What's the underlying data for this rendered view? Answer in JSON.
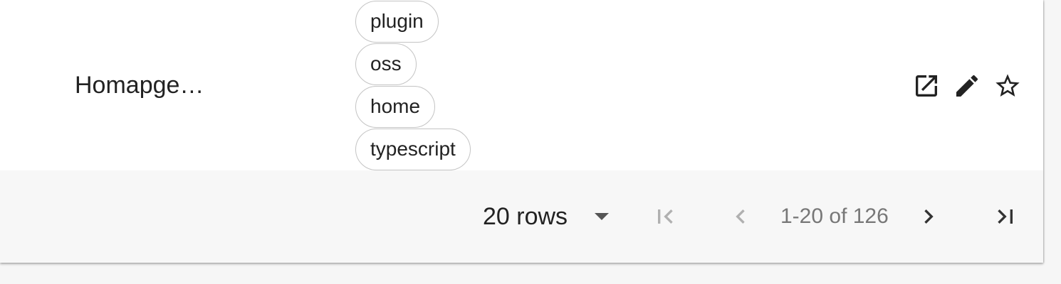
{
  "row": {
    "title": "Homapge…",
    "tags": [
      "plugin",
      "oss",
      "home",
      "typescript"
    ],
    "actions": [
      {
        "icon": "open-in-new-icon"
      },
      {
        "icon": "edit-pencil-icon"
      },
      {
        "icon": "star-outline-icon"
      }
    ]
  },
  "pagination": {
    "rows_label": "20 rows",
    "status": "1-20 of 126",
    "first_icon": "first-page-icon",
    "prev_icon": "chevron-left-icon",
    "next_icon": "chevron-right-icon",
    "last_icon": "last-page-icon"
  },
  "colors": {
    "text": "#222222",
    "muted": "#777777",
    "disabled_icon": "#b0b0b0",
    "footer_bg": "#f7f7f7",
    "chip_border": "#c4c4c4"
  }
}
